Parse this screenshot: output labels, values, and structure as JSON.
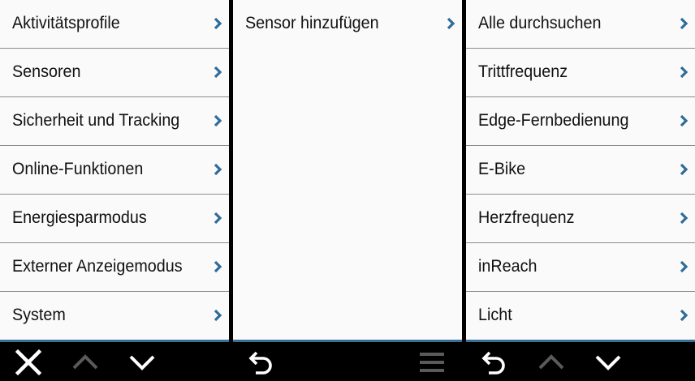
{
  "colors": {
    "list_background": "#fafafa",
    "divider": "#8c8c8c",
    "chevron": "#2f6c9a",
    "toolbar_background": "#000000",
    "toolbar_accent": "#3a6f95",
    "icon_active": "#ffffff",
    "icon_disabled": "#5a5a5a"
  },
  "left_menu": {
    "items": [
      {
        "label": "Aktivitätsprofile"
      },
      {
        "label": "Sensoren"
      },
      {
        "label": "Sicherheit und Tracking"
      },
      {
        "label": "Online-Funktionen"
      },
      {
        "label": "Energiesparmodus"
      },
      {
        "label": "Externer Anzeigemodus"
      },
      {
        "label": "System"
      }
    ],
    "toolbar": {
      "close_icon": "close-icon",
      "up_icon": "chevron-up-icon",
      "down_icon": "chevron-down-icon"
    }
  },
  "middle_menu": {
    "items": [
      {
        "label": "Sensor hinzufügen"
      }
    ],
    "toolbar": {
      "back_icon": "back-icon",
      "menu_icon": "menu-icon"
    }
  },
  "right_menu": {
    "items": [
      {
        "label": "Alle durchsuchen"
      },
      {
        "label": "Trittfrequenz"
      },
      {
        "label": "Edge-Fernbedienung"
      },
      {
        "label": "E-Bike"
      },
      {
        "label": "Herzfrequenz"
      },
      {
        "label": "inReach"
      },
      {
        "label": "Licht"
      }
    ],
    "toolbar": {
      "back_icon": "back-icon",
      "up_icon": "chevron-up-icon",
      "down_icon": "chevron-down-icon"
    }
  }
}
